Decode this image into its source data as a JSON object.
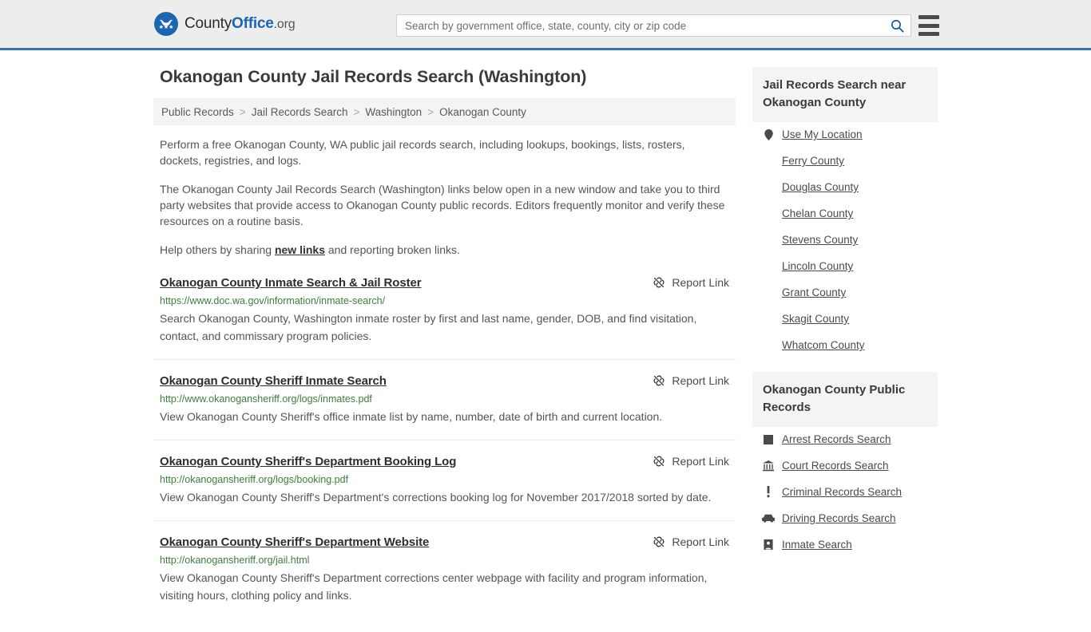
{
  "header": {
    "brand": {
      "part1": "County",
      "part2": "Office",
      "part3": ".org",
      "logo_icon": "eagle-seal-icon"
    },
    "search": {
      "placeholder": "Search by government office, state, county, city or zip code",
      "value": "",
      "button_icon": "search-icon"
    },
    "menu_icon": "hamburger-menu-icon",
    "accent_color": "#3a73a8"
  },
  "page": {
    "title": "Okanogan County Jail Records Search (Washington)"
  },
  "breadcrumb": {
    "items": [
      "Public Records",
      "Jail Records Search",
      "Washington",
      "Okanogan County"
    ],
    "separator": ">"
  },
  "intro": {
    "p1": "Perform a free Okanogan County, WA public jail records search, including lookups, bookings, lists, rosters, dockets, registries, and logs.",
    "p2": "The Okanogan County Jail Records Search (Washington) links below open in a new window and take you to third party websites that provide access to Okanogan County public records. Editors frequently monitor and verify these resources on a routine basis.",
    "p3_before": "Help others by sharing ",
    "p3_link": "new links",
    "p3_after": " and reporting broken links."
  },
  "results": {
    "report_label": "Report Link",
    "report_icon": "broken-link-icon",
    "items": [
      {
        "title": "Okanogan County Inmate Search & Jail Roster",
        "url": "https://www.doc.wa.gov/information/inmate-search/",
        "description": "Search Okanogan County, Washington inmate roster by first and last name, gender, DOB, and find visitation, contact, and commissary program policies."
      },
      {
        "title": "Okanogan County Sheriff Inmate Search",
        "url": "http://www.okanogansheriff.org/logs/inmates.pdf",
        "description": "View Okanogan County Sheriff's office inmate list by name, number, date of birth and current location."
      },
      {
        "title": "Okanogan County Sheriff's Department Booking Log",
        "url": "http://okanogansheriff.org/logs/booking.pdf",
        "description": "View Okanogan County Sheriff's Department's corrections booking log for November 2017/2018 sorted by date."
      },
      {
        "title": "Okanogan County Sheriff's Department Website",
        "url": "http://okanogansheriff.org/jail.html",
        "description": "View Okanogan County Sheriff's Department corrections center webpage with facility and program information, visiting hours, clothing policy and links."
      }
    ]
  },
  "sidebar": {
    "nearby": {
      "heading": "Jail Records Search near Okanogan County",
      "items": [
        {
          "label": "Use My Location",
          "icon": "map-pin-icon"
        },
        {
          "label": "Ferry County",
          "icon": ""
        },
        {
          "label": "Douglas County",
          "icon": ""
        },
        {
          "label": "Chelan County",
          "icon": ""
        },
        {
          "label": "Stevens County",
          "icon": ""
        },
        {
          "label": "Lincoln County",
          "icon": ""
        },
        {
          "label": "Grant County",
          "icon": ""
        },
        {
          "label": "Skagit County",
          "icon": ""
        },
        {
          "label": "Whatcom County",
          "icon": ""
        }
      ]
    },
    "public_records": {
      "heading": "Okanogan County Public Records",
      "items": [
        {
          "label": "Arrest Records Search",
          "icon": "fingerprint-icon"
        },
        {
          "label": "Court Records Search",
          "icon": "courthouse-icon"
        },
        {
          "label": "Criminal Records Search",
          "icon": "exclamation-icon"
        },
        {
          "label": "Driving Records Search",
          "icon": "car-icon"
        },
        {
          "label": "Inmate Search",
          "icon": "prisoner-icon"
        }
      ]
    }
  }
}
